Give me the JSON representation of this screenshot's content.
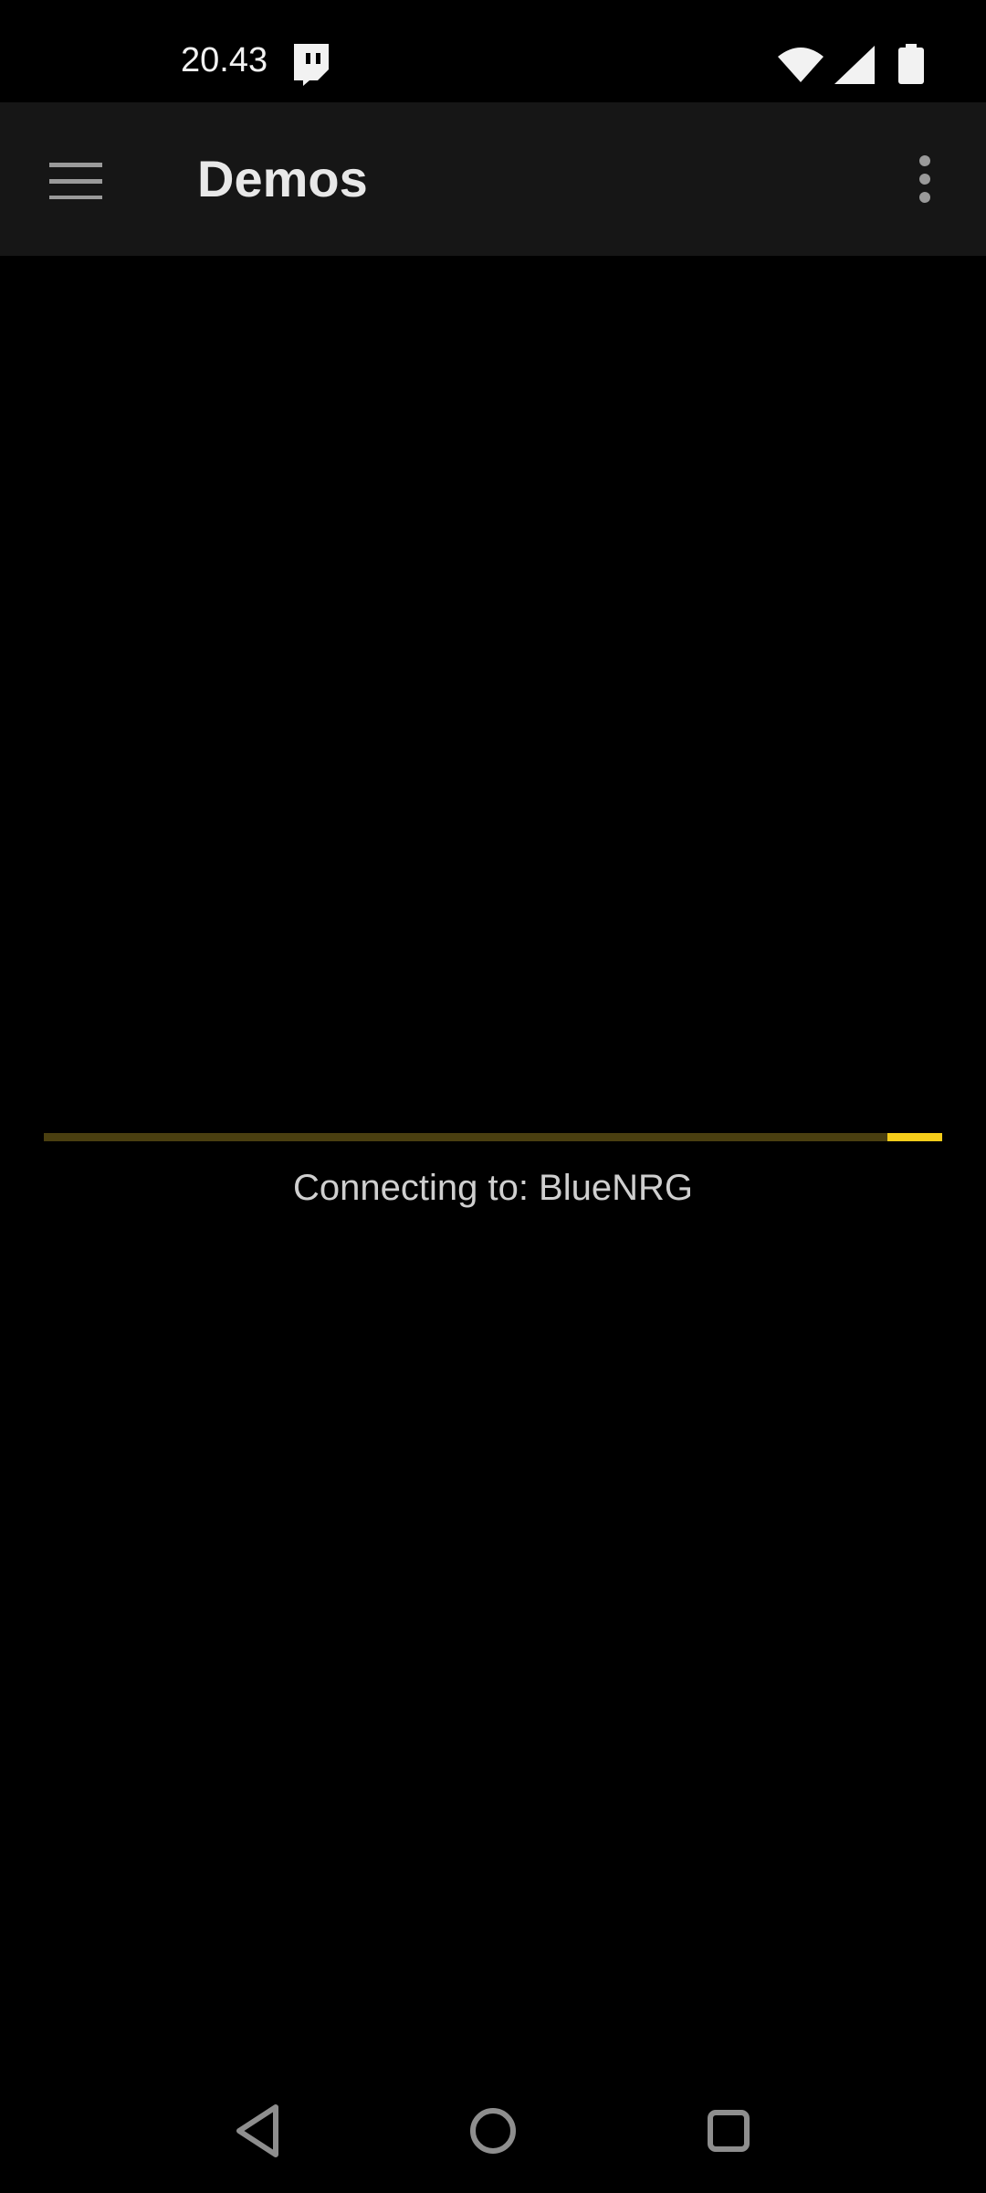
{
  "status_bar": {
    "time": "20.43",
    "notification_icon": "twitch-icon",
    "wifi_icon": "wifi-icon",
    "signal_icon": "cellular-signal-icon",
    "battery_icon": "battery-icon"
  },
  "app_bar": {
    "title": "Demos",
    "menu_icon": "hamburger-menu-icon",
    "overflow_icon": "more-vert-icon"
  },
  "progress": {
    "message": "Connecting to: BlueNRG",
    "indicator_start_fraction": 0.939,
    "indicator_end_fraction": 1.0,
    "track_color": "#4a3f10",
    "indicator_color": "#f5cc1a"
  },
  "nav_bar": {
    "back_icon": "back-triangle-icon",
    "home_icon": "home-circle-icon",
    "recents_icon": "recents-square-icon"
  },
  "colors": {
    "background": "#000000",
    "app_bar": "#161616",
    "accent": "#f5cc1a"
  }
}
